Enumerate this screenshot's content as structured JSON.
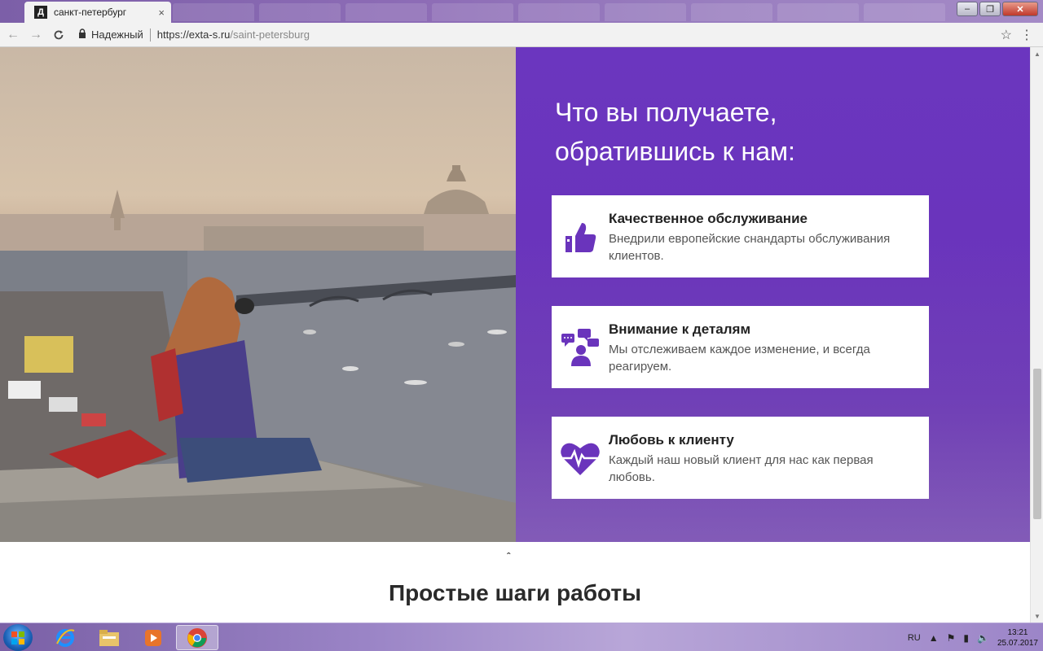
{
  "browser": {
    "tab_title": "санкт-петербург",
    "tab_favicon": "Д",
    "secure_label": "Надежный",
    "url_base": "https://exta-s.ru",
    "url_path": "/saint-petersburg",
    "back_icon": "←",
    "forward_icon": "→",
    "reload_icon": "C",
    "star_icon": "☆",
    "menu_icon": "⋮",
    "close_tab_icon": "×"
  },
  "hero": {
    "heading_line1": "Что вы получаете,",
    "heading_line2": "обратившись к нам:",
    "cards": [
      {
        "title": "Качественное обслуживание",
        "desc": "Внедрили европейские снандарты обслуживания клиентов.",
        "icon": "thumbs-up-icon"
      },
      {
        "title": "Внимание к деталям",
        "desc": "Мы отслеживаем каждое изменение, и всегда реагируем.",
        "icon": "chat-people-icon"
      },
      {
        "title": "Любовь к клиенту",
        "desc": "Каждый наш новый клиент для нас как первая любовь.",
        "icon": "heart-pulse-icon"
      }
    ],
    "accent_color": "#6a34bc"
  },
  "section": {
    "caret": "ˆ",
    "title": "Простые шаги работы"
  },
  "taskbar": {
    "lang": "RU",
    "time": "13:21",
    "date": "25.07.2017"
  }
}
